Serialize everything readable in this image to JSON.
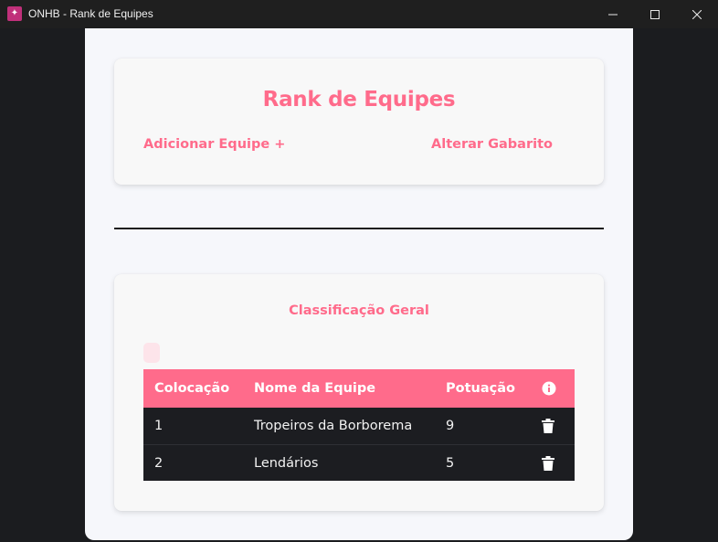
{
  "window": {
    "title": "ONHB - Rank de Equipes",
    "app_icon": "onhb-app-icon",
    "controls": [
      "minimize-icon",
      "maximize-icon",
      "close-icon"
    ]
  },
  "header": {
    "title": "Rank de Equipes",
    "add_team_label": "Adicionar Equipe +",
    "alter_key_label": "Alterar Gabarito"
  },
  "ranking": {
    "title": "Classificação Geral",
    "columns": [
      "Colocação",
      "Nome da Equipe",
      "Potuação"
    ],
    "info_icon": "info-icon",
    "delete_icon": "trash-icon",
    "rows": [
      {
        "position": "1",
        "team": "Tropeiros da Borborema",
        "score": "9"
      },
      {
        "position": "2",
        "team": "Lendários",
        "score": "5"
      }
    ]
  },
  "colors": {
    "accent": "#ff6b8b",
    "table_row_bg": "#1c1d21",
    "page_bg": "#f6f7fb",
    "window_bg": "#1b1c1f"
  }
}
